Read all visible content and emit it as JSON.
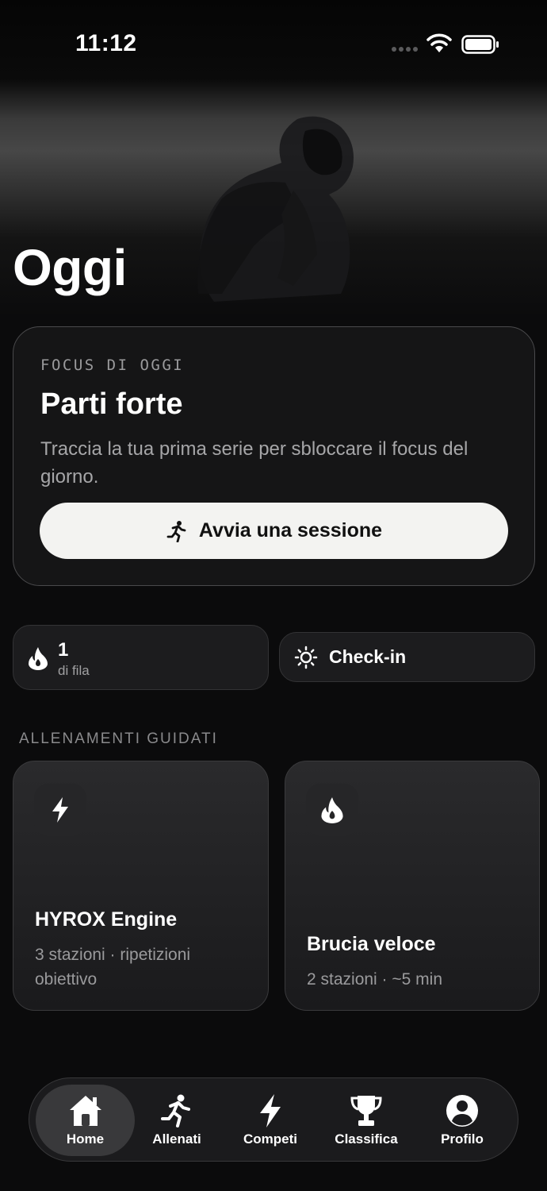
{
  "status_bar": {
    "time": "11:12"
  },
  "page": {
    "title": "Oggi"
  },
  "focus_card": {
    "eyebrow": "FOCUS DI OGGI",
    "title": "Parti forte",
    "description": "Traccia la tua prima serie per sbloccare il focus del giorno.",
    "button_label": "Avvia una sessione",
    "button_icon": "running-person-icon"
  },
  "streak": {
    "count": "1",
    "label": "di fila",
    "icon": "flame-icon"
  },
  "checkin": {
    "label": "Check-in",
    "icon": "sun-icon"
  },
  "guided": {
    "section_title": "ALLENAMENTI GUIDATI",
    "workouts": [
      {
        "title": "HYROX Engine",
        "meta": "3 stazioni · ripetizioni obiettivo",
        "icon": "lightning-icon"
      },
      {
        "title": "Brucia veloce",
        "meta": "2 stazioni · ~5 min",
        "icon": "flame-icon"
      }
    ]
  },
  "tab_bar": {
    "active": "Home",
    "tabs": [
      {
        "label": "Home",
        "icon": "house-icon"
      },
      {
        "label": "Allenati",
        "icon": "running-person-icon"
      },
      {
        "label": "Competi",
        "icon": "lightning-icon"
      },
      {
        "label": "Classifica",
        "icon": "trophy-icon"
      },
      {
        "label": "Profilo",
        "icon": "person-circle-icon"
      }
    ]
  },
  "colors": {
    "background": "#0b0b0c",
    "card": "#151516",
    "pill": "#1c1c1e",
    "primary_button": "#f3f3f1",
    "secondary_text": "#a6a6a8"
  }
}
